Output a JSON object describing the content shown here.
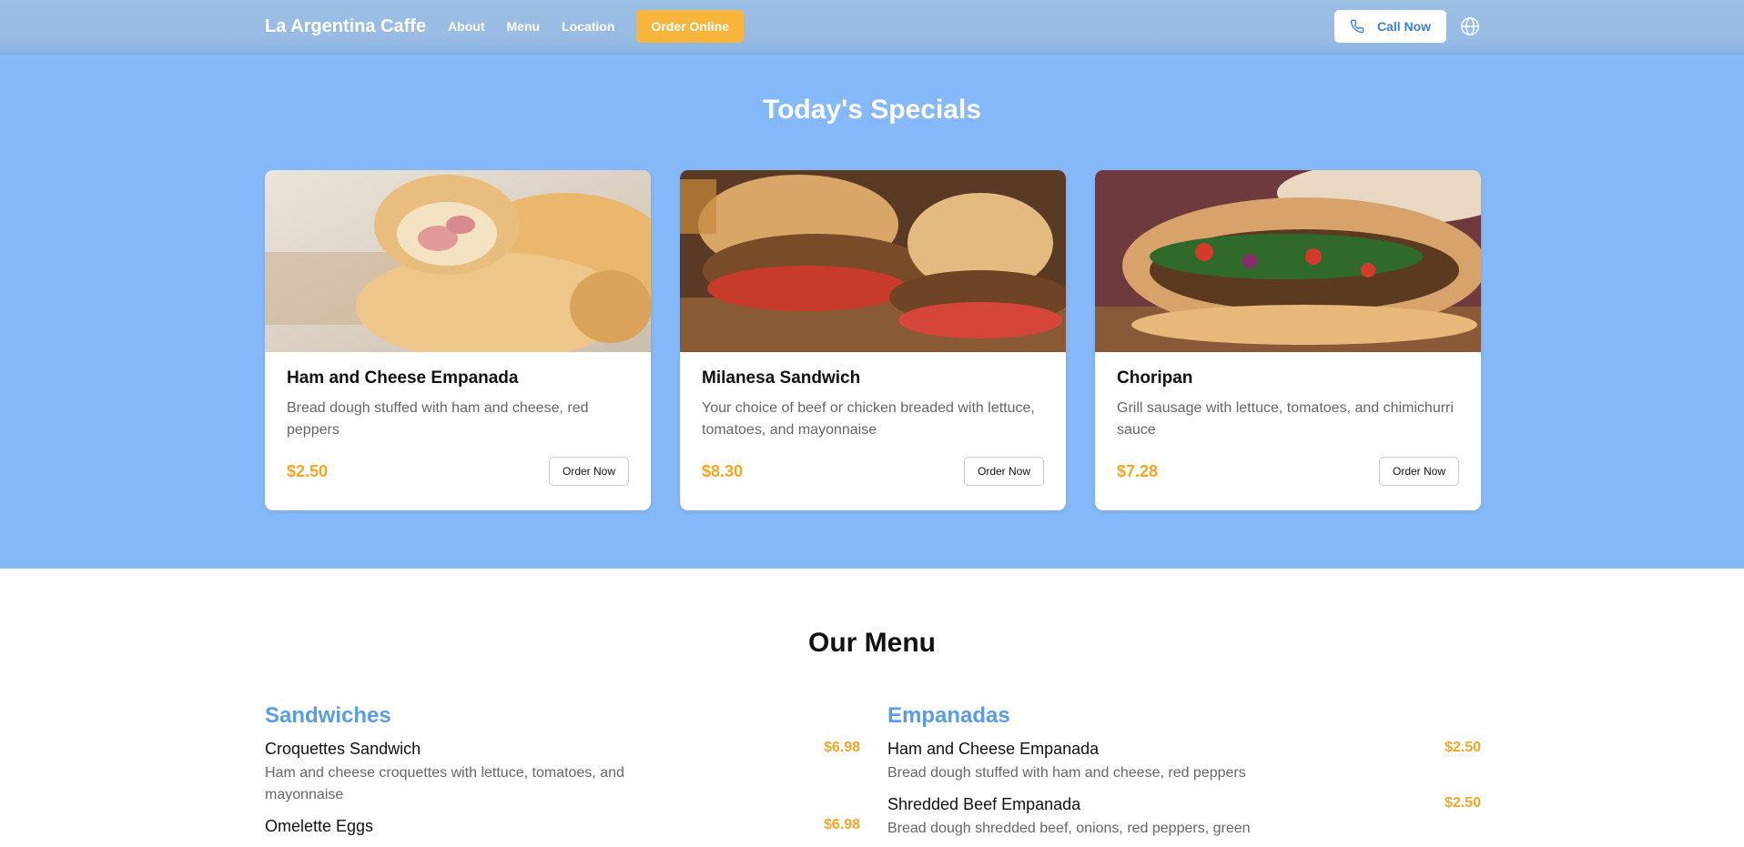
{
  "nav": {
    "brand": "La Argentina Caffe",
    "links": [
      "About",
      "Menu",
      "Location"
    ],
    "order_online": "Order Online",
    "call_now": "Call Now"
  },
  "specials": {
    "title": "Today's Specials",
    "cards": [
      {
        "name": "Ham and Cheese Empanada",
        "desc": "Bread dough stuffed with ham and cheese, red peppers",
        "price": "$2.50",
        "button": "Order Now"
      },
      {
        "name": "Milanesa Sandwich",
        "desc": "Your choice of beef or chicken breaded with lettuce, tomatoes, and mayonnaise",
        "price": "$8.30",
        "button": "Order Now"
      },
      {
        "name": "Choripan",
        "desc": "Grill sausage with lettuce, tomatoes, and chimichurri sauce",
        "price": "$7.28",
        "button": "Order Now"
      }
    ]
  },
  "menu": {
    "title": "Our Menu",
    "sandwiches": {
      "heading": "Sandwiches",
      "items": [
        {
          "name": "Croquettes Sandwich",
          "price": "$6.98",
          "desc": "Ham and cheese croquettes with lettuce, tomatoes, and mayonnaise"
        },
        {
          "name": "Omelette Eggs",
          "price": "$6.98",
          "desc": ""
        }
      ]
    },
    "empanadas": {
      "heading": "Empanadas",
      "items": [
        {
          "name": "Ham and Cheese Empanada",
          "price": "$2.50",
          "desc": "Bread dough stuffed with ham and cheese, red peppers"
        },
        {
          "name": "Shredded Beef Empanada",
          "price": "$2.50",
          "desc": "Bread dough shredded beef, onions, red peppers, green"
        }
      ]
    }
  },
  "colors": {
    "accent": "#f5a623",
    "hero_bg": "#86b9f9",
    "heading_blue": "#5a9de0"
  }
}
